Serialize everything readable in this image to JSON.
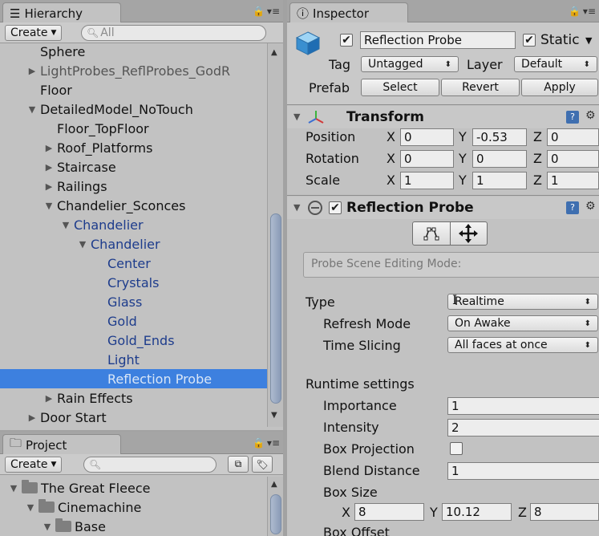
{
  "hierarchy": {
    "tab_label": "Hierarchy",
    "create_label": "Create",
    "search_placeholder": "All",
    "rows": [
      {
        "label": "Sphere",
        "arrow": "",
        "indent": 0,
        "style": ""
      },
      {
        "label": "LightProbes_ReflProbes_GodR",
        "arrow": "▶",
        "indent": 0,
        "style": "dim"
      },
      {
        "label": "Floor",
        "arrow": "",
        "indent": 0,
        "style": ""
      },
      {
        "label": "DetailedModel_NoTouch",
        "arrow": "▼",
        "indent": 0,
        "style": ""
      },
      {
        "label": "Floor_TopFloor",
        "arrow": "",
        "indent": 1,
        "style": ""
      },
      {
        "label": "Roof_Platforms",
        "arrow": "▶",
        "indent": 1,
        "style": ""
      },
      {
        "label": "Staircase",
        "arrow": "▶",
        "indent": 1,
        "style": ""
      },
      {
        "label": "Railings",
        "arrow": "▶",
        "indent": 1,
        "style": ""
      },
      {
        "label": "Chandelier_Sconces",
        "arrow": "▼",
        "indent": 1,
        "style": ""
      },
      {
        "label": "Chandelier",
        "arrow": "▼",
        "indent": 2,
        "style": "blue"
      },
      {
        "label": "Chandelier",
        "arrow": "▼",
        "indent": 3,
        "style": "blue"
      },
      {
        "label": "Center",
        "arrow": "",
        "indent": 4,
        "style": "blue"
      },
      {
        "label": "Crystals",
        "arrow": "",
        "indent": 4,
        "style": "blue"
      },
      {
        "label": "Glass",
        "arrow": "",
        "indent": 4,
        "style": "blue"
      },
      {
        "label": "Gold",
        "arrow": "",
        "indent": 4,
        "style": "blue"
      },
      {
        "label": "Gold_Ends",
        "arrow": "",
        "indent": 4,
        "style": "blue"
      },
      {
        "label": "Light",
        "arrow": "",
        "indent": 4,
        "style": "blue"
      },
      {
        "label": "Reflection Probe",
        "arrow": "",
        "indent": 4,
        "style": "selected"
      },
      {
        "label": "Rain Effects",
        "arrow": "▶",
        "indent": 1,
        "style": ""
      },
      {
        "label": "Door Start",
        "arrow": "▶",
        "indent": 0,
        "style": ""
      }
    ]
  },
  "project": {
    "tab_label": "Project",
    "create_label": "Create",
    "rows": [
      {
        "label": "The Great Fleece",
        "indent": 0
      },
      {
        "label": "Cinemachine",
        "indent": 1
      },
      {
        "label": "Base",
        "indent": 2
      }
    ]
  },
  "inspector": {
    "tab_label": "Inspector",
    "object_name": "Reflection Probe",
    "static_label": "Static",
    "tag_label": "Tag",
    "tag_value": "Untagged",
    "layer_label": "Layer",
    "layer_value": "Default",
    "prefab_label": "Prefab",
    "prefab_buttons": [
      "Select",
      "Revert",
      "Apply"
    ],
    "transform": {
      "title": "Transform",
      "rows": [
        {
          "label": "Position",
          "x": "0",
          "y": "-0.53",
          "z": "0"
        },
        {
          "label": "Rotation",
          "x": "0",
          "y": "0",
          "z": "0"
        },
        {
          "label": "Scale",
          "x": "1",
          "y": "1",
          "z": "1"
        }
      ]
    },
    "probe": {
      "title": "Reflection Probe",
      "editing_mode_label": "Probe Scene Editing Mode:",
      "type_label": "Type",
      "type_value": "Realtime",
      "refresh_label": "Refresh Mode",
      "refresh_value": "On Awake",
      "slicing_label": "Time Slicing",
      "slicing_value": "All faces at once",
      "runtime_label": "Runtime settings",
      "importance_label": "Importance",
      "importance_value": "1",
      "intensity_label": "Intensity",
      "intensity_value": "2",
      "box_projection_label": "Box Projection",
      "blend_label": "Blend Distance",
      "blend_value": "1",
      "box_size_label": "Box Size",
      "box_size": {
        "x": "8",
        "y": "10.12",
        "z": "8"
      },
      "box_offset_label": "Box Offset"
    }
  },
  "axis_labels": {
    "x": "X",
    "y": "Y",
    "z": "Z"
  }
}
